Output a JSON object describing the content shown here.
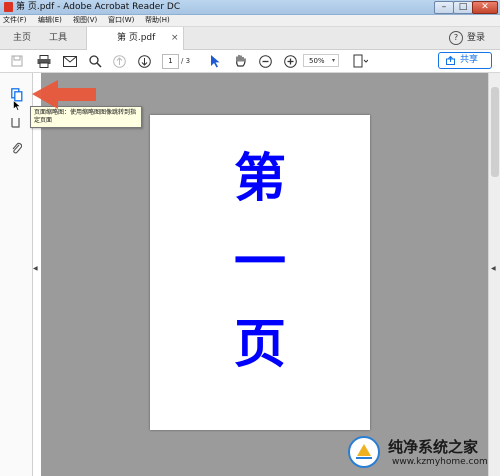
{
  "window": {
    "title": "第 页.pdf - Adobe Acrobat Reader DC",
    "minimize_label": "–",
    "maximize_label": "□",
    "close_label": "✕"
  },
  "menu": [
    {
      "label": "文件(F)"
    },
    {
      "label": "编辑(E)"
    },
    {
      "label": "视图(V)"
    },
    {
      "label": "窗口(W)"
    },
    {
      "label": "帮助(H)"
    }
  ],
  "tabs": {
    "home": "主页",
    "tools": "工具",
    "document": "第 页.pdf",
    "close_glyph": "×",
    "login": "登录",
    "help_glyph": "?"
  },
  "toolbar": {
    "page_current": "1",
    "page_total": "/ 3",
    "zoom": "50%",
    "zoom_arrow": "▾",
    "share_label": "共享"
  },
  "tooltip": {
    "text": "页面缩略图：使用缩略图图像跳转到指定页面"
  },
  "document_page": {
    "lines": [
      "第",
      "一",
      "页"
    ],
    "text_color": "#0000ff"
  },
  "pane": {
    "collapse_glyph": "◀",
    "expand_glyph": "◀"
  },
  "watermark": {
    "title": "纯净系统之家",
    "url": "www.kzmyhome.com"
  },
  "colors": {
    "accent": "#1473e6",
    "arrow": "#e8573a",
    "page_background": "#9b9b9b"
  }
}
